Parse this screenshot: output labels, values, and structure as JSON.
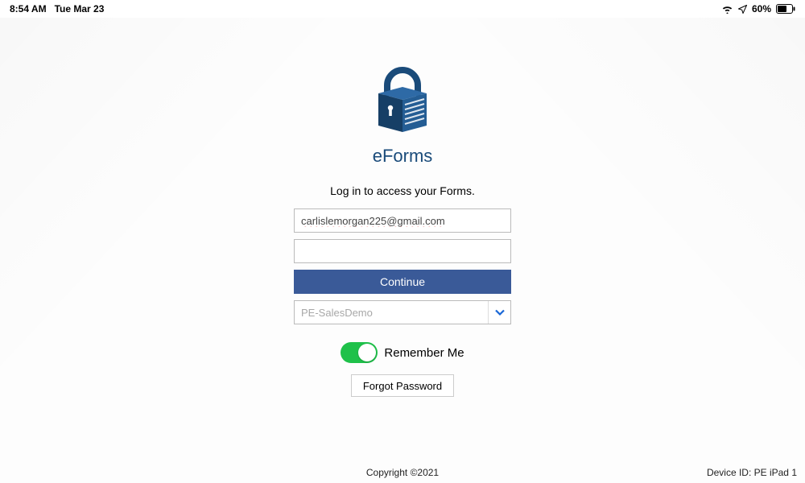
{
  "status": {
    "time": "8:54 AM",
    "date": "Tue Mar 23",
    "battery_pct": "60%"
  },
  "app": {
    "name": "eForms",
    "subtitle": "Log in to access your Forms."
  },
  "form": {
    "email_value": "carlislemorgan225@gmail.com",
    "password_value": "",
    "continue_label": "Continue",
    "org_selected": "PE-SalesDemo"
  },
  "remember": {
    "label": "Remember Me",
    "on": true
  },
  "forgot_label": "Forgot Password",
  "footer": {
    "copyright": "Copyright ©2021",
    "device_id": "Device ID: PE iPad 1"
  }
}
